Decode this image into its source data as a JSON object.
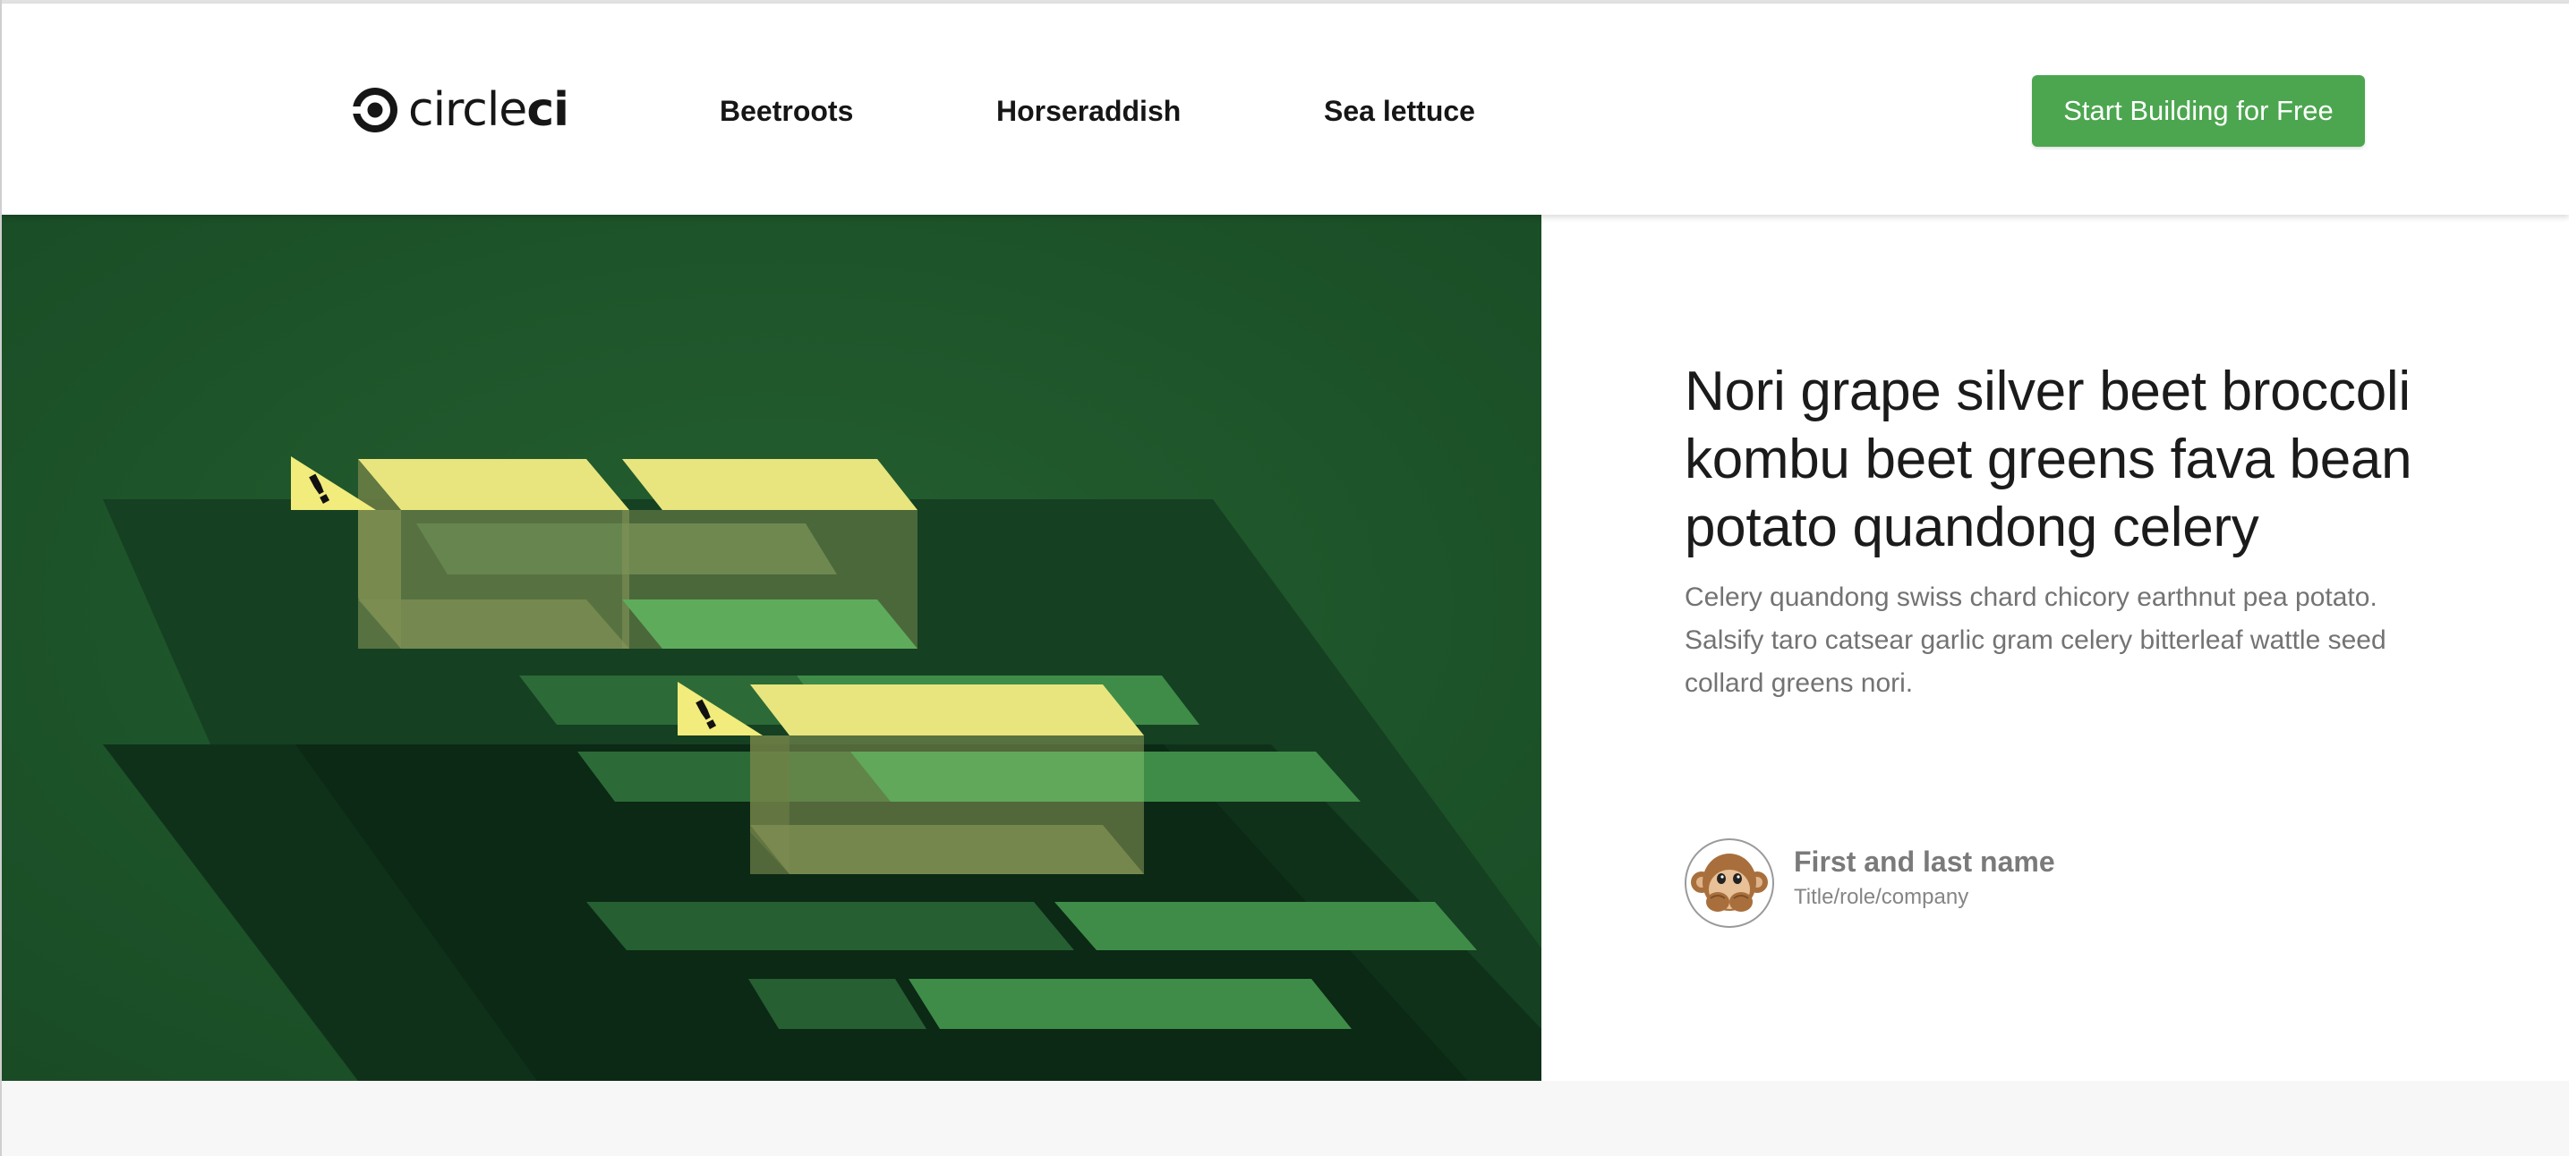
{
  "brand": {
    "name_light": "circle",
    "name_bold": "ci",
    "icon": "circleci-logo-icon"
  },
  "nav": {
    "items": [
      {
        "label": "Beetroots"
      },
      {
        "label": "Horseraddish"
      },
      {
        "label": "Sea lettuce"
      }
    ],
    "cta_label": "Start Building for Free"
  },
  "hero": {
    "headline": "Nori grape silver beet broccoli kombu beet greens fava bean potato quandong celery",
    "lead": "Celery quandong swiss chard chicory earthnut pea potato. Salsify taro catsear garlic gram celery bitterleaf wattle seed collard greens nori.",
    "illustration": {
      "icons": [
        "warning-icon",
        "warning-icon"
      ]
    }
  },
  "testimonial": {
    "avatar_icon": "monkey-emoji-icon",
    "name": "First and last name",
    "role": "Title/role/company"
  },
  "colors": {
    "cta": "#4ca64f",
    "hero_bg": "#1f5a2c",
    "block_yellow": "#e8e57f",
    "block_green": "#5fab5c",
    "headline": "#1b1b1b",
    "body_text": "#737373"
  }
}
